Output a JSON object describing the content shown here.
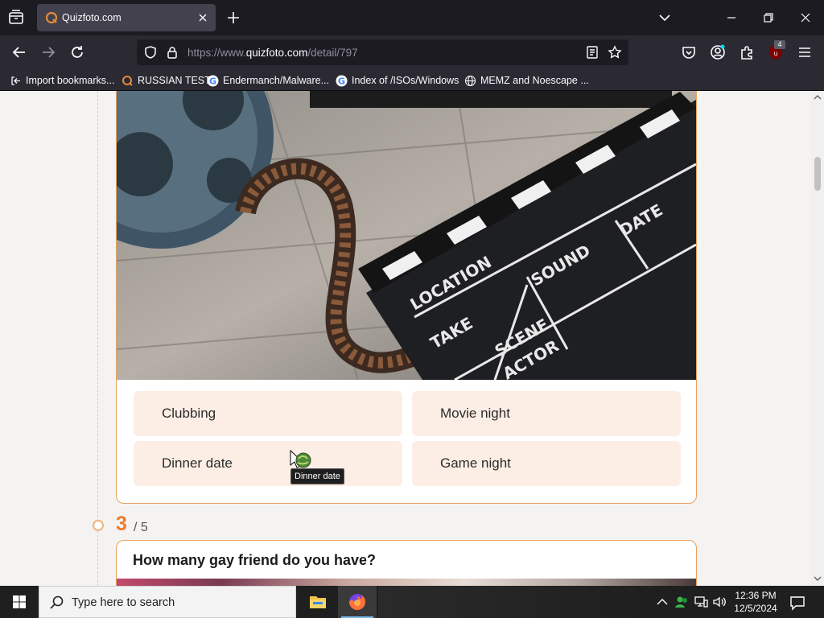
{
  "browser": {
    "tab": {
      "title": "Quizfoto.com"
    },
    "url": {
      "prefix": "https://www.",
      "domain": "quizfoto.com",
      "path": "/detail/797"
    },
    "extensions_badge": "4",
    "bookmarks": [
      {
        "label": "Import bookmarks...",
        "icon": "import-icon"
      },
      {
        "label": "RUSSIAN TEST",
        "icon": "quizfoto-icon"
      },
      {
        "label": "Endermanch/Malware...",
        "icon": "google-icon"
      },
      {
        "label": "Index of /ISOs/Windows",
        "icon": "google-icon"
      },
      {
        "label": "MEMZ and Noescape ...",
        "icon": "globe-icon"
      }
    ]
  },
  "quiz": {
    "answers": [
      "Clubbing",
      "Movie night",
      "Dinner date",
      "Game night"
    ],
    "tooltip": "Dinner date",
    "next": {
      "number": "3",
      "total": "/ 5",
      "question": "How many gay friend do you have?"
    }
  },
  "taskbar": {
    "search_placeholder": "Type here to search",
    "time": "12:36 PM",
    "date": "12/5/2024"
  },
  "colors": {
    "accent": "#ee7c2b",
    "card_border": "#e8a15e",
    "answer_bg": "#fdeee5"
  }
}
